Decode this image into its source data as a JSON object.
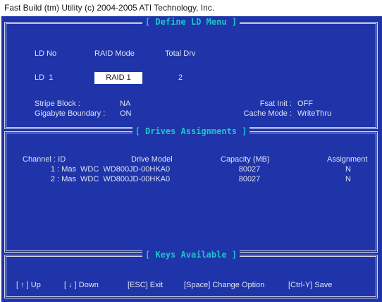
{
  "app_title": "Fast Build (tm) Utility (c) 2004-2005 ATI Technology, Inc.",
  "define_menu": {
    "title": "[ Define LD Menu ]",
    "ld_no_header": "LD No",
    "raid_mode_header": "RAID Mode",
    "total_drv_header": "Total Drv",
    "ld_value": "LD  1",
    "raid_mode_value": "RAID 1",
    "total_drv_value": "2",
    "stripe_block_label": "Stripe Block :",
    "stripe_block_value": "NA",
    "gigabyte_boundary_label": "Gigabyte Boundary :",
    "gigabyte_boundary_value": "ON",
    "fast_init_label": "Fsat Init :",
    "fast_init_value": "OFF",
    "cache_mode_label": "Cache Mode :",
    "cache_mode_value": "WriteThru"
  },
  "drives": {
    "title": "[ Drives Assignments ]",
    "headers": {
      "channel": "Channel : ID",
      "model": "Drive Model",
      "capacity": "Capacity (MB)",
      "assignment": "Assignment"
    },
    "rows": [
      {
        "channel": "1 : Mas",
        "model": "WDC  WD800JD-00HKA0",
        "capacity": "80027",
        "assignment": "N"
      },
      {
        "channel": "2 : Mas",
        "model": "WDC  WD800JD-00HKA0",
        "capacity": "80027",
        "assignment": "N"
      }
    ]
  },
  "keys": {
    "title": "[ Keys Available ]",
    "up": "[ ↑ ] Up",
    "down": "[ ↓ ] Down",
    "esc": "[ESC] Exit",
    "space": "[Space] Change Option",
    "ctrl_y": "[Ctrl-Y] Save"
  }
}
